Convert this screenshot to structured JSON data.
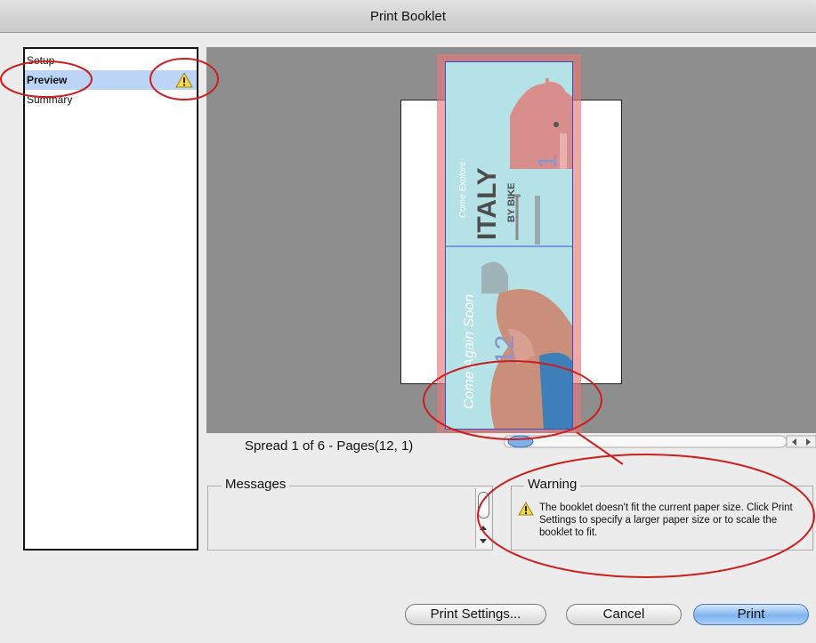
{
  "window": {
    "title": "Print Booklet"
  },
  "sidebar": {
    "items": [
      {
        "label": "Setup",
        "selected": false
      },
      {
        "label": "Preview",
        "selected": true,
        "badge": "warning-icon"
      },
      {
        "label": "Summary",
        "selected": false
      }
    ]
  },
  "preview": {
    "spread_label": "Spread 1 of 6 - Pages(12, 1)",
    "booklet_pages": [
      {
        "page_number": "1",
        "title": "ITALY",
        "subtitle": "BY BIKE",
        "script_text": "Come Explore"
      },
      {
        "page_number": "12",
        "script_text": "Come Again Soon"
      }
    ]
  },
  "messages": {
    "title": "Messages"
  },
  "warning": {
    "title": "Warning",
    "text": "The booklet doesn't fit the current paper size. Click Print Settings to specify a larger paper size or to scale the booklet to fit."
  },
  "buttons": {
    "print_settings": "Print Settings...",
    "cancel": "Cancel",
    "print": "Print"
  },
  "colors": {
    "selection": "#bcd5f7",
    "annotation": "#cc1f1f",
    "booklet_overlay": "#e67878",
    "page_bg": "#b4e2e6",
    "primary_button": "#7fb3f0"
  }
}
